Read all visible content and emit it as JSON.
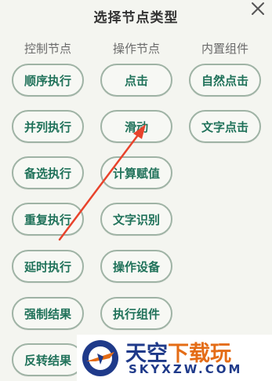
{
  "dialog": {
    "title": "选择节点类型",
    "close_icon": "close-icon"
  },
  "columns": [
    {
      "header": "控制节点",
      "items": [
        "顺序执行",
        "并列执行",
        "备选执行",
        "重复执行",
        "延时执行",
        "强制结果",
        "反转结果"
      ]
    },
    {
      "header": "操作节点",
      "items": [
        "点击",
        "滑动",
        "计算赋值",
        "文字识别",
        "操作设备",
        "执行组件"
      ]
    },
    {
      "header": "内置组件",
      "items": [
        "自然点击",
        "文字点击"
      ]
    }
  ],
  "annotation": {
    "arrow_color": "#e8432c",
    "points_to": "滑动"
  },
  "watermark": {
    "name_part1": "天空",
    "name_part2": "下载玩",
    "domain": "SKYXZW.COM",
    "brand_colors": [
      "#1f3a8a",
      "#e46c16"
    ]
  }
}
